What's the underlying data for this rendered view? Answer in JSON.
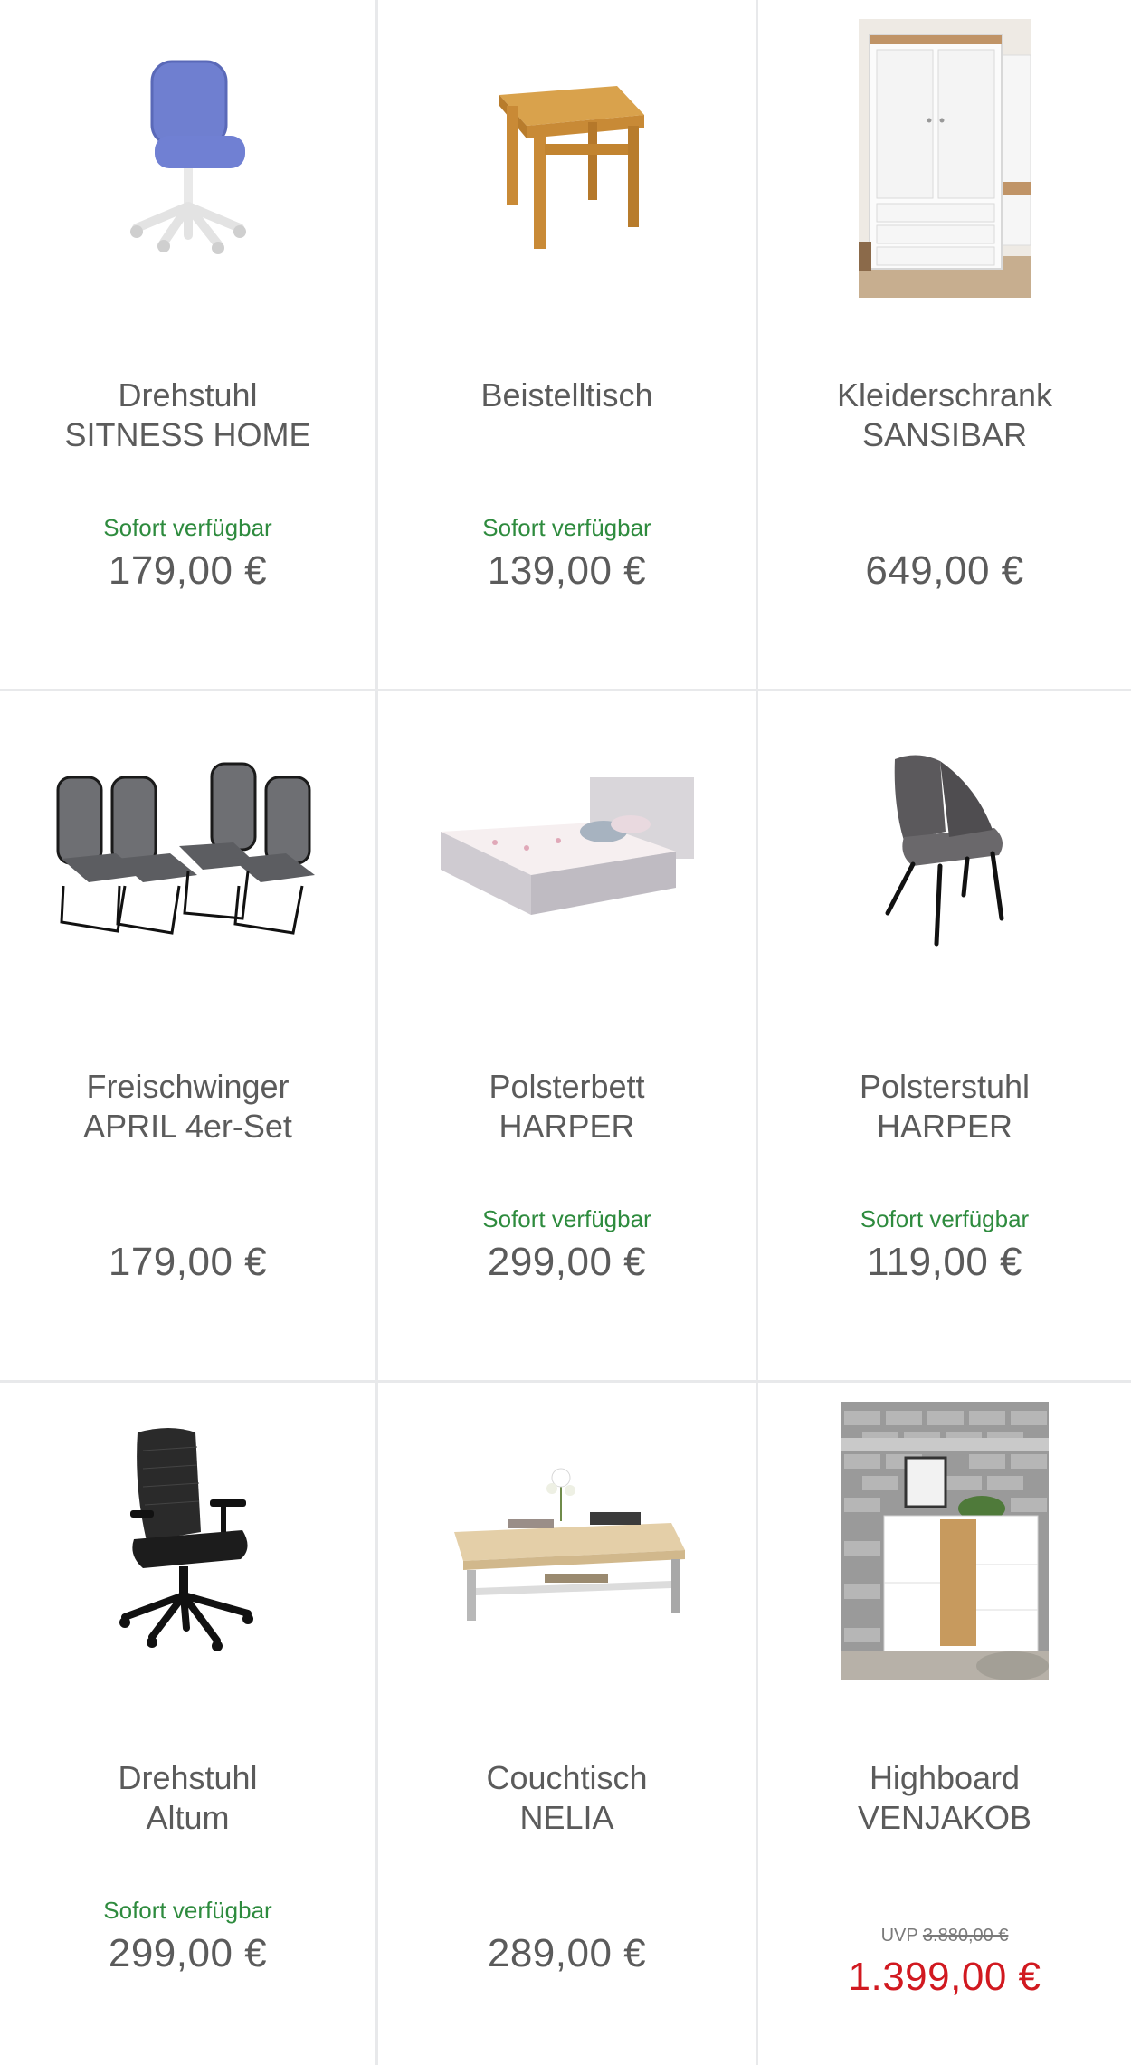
{
  "products": [
    {
      "name_line1": "Drehstuhl",
      "name_line2": "SITNESS HOME",
      "availability": "Sofort verfügbar",
      "price": "179,00 €",
      "image_icon": "swivel-chair-blue-icon"
    },
    {
      "name_line1": "Beistelltisch",
      "name_line2": "",
      "availability": "Sofort verfügbar",
      "price": "139,00 €",
      "image_icon": "side-table-icon"
    },
    {
      "name_line1": "Kleiderschrank",
      "name_line2": "SANSIBAR",
      "availability": "",
      "price": "649,00 €",
      "image_icon": "wardrobe-icon"
    },
    {
      "name_line1": "Freischwinger",
      "name_line2": "APRIL 4er-Set",
      "availability": "",
      "price": "179,00 €",
      "image_icon": "cantilever-chairs-icon"
    },
    {
      "name_line1": "Polsterbett",
      "name_line2": "HARPER",
      "availability": "Sofort verfügbar",
      "price": "299,00 €",
      "image_icon": "upholstered-bed-icon"
    },
    {
      "name_line1": "Polsterstuhl",
      "name_line2": "HARPER",
      "availability": "Sofort verfügbar",
      "price": "119,00 €",
      "image_icon": "upholstered-chair-icon"
    },
    {
      "name_line1": "Drehstuhl",
      "name_line2": "Altum",
      "availability": "Sofort verfügbar",
      "price": "299,00 €",
      "image_icon": "office-chair-black-icon"
    },
    {
      "name_line1": "Couchtisch",
      "name_line2": "NELIA",
      "availability": "",
      "price": "289,00 €",
      "image_icon": "coffee-table-icon"
    },
    {
      "name_line1": "Highboard",
      "name_line2": "VENJAKOB",
      "availability": "",
      "uvp_label": "UVP",
      "uvp_price": "3.880,00 €",
      "price": "1.399,00 €",
      "image_icon": "highboard-icon"
    }
  ],
  "colors": {
    "availability": "#2e8b3e",
    "price": "#5b5b5b",
    "sale_price": "#d11920",
    "divider": "#e8e9eb"
  }
}
